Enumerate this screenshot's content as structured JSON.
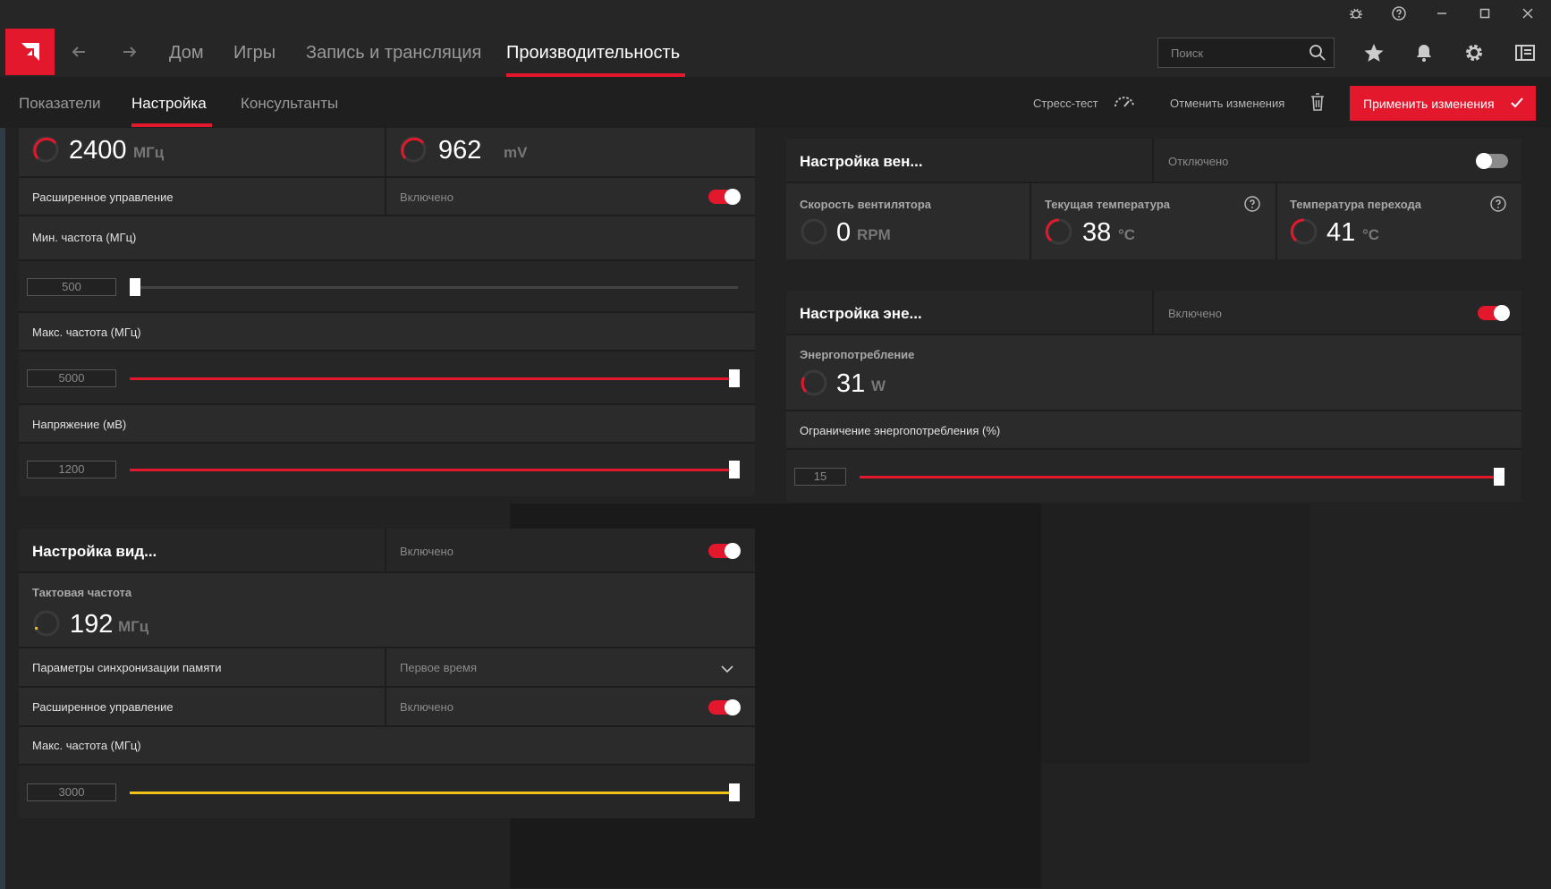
{
  "colors": {
    "accent": "#e3182d",
    "yellow": "#f2c21b",
    "panel": "#2b2b2b"
  },
  "nav": {
    "tabs": [
      {
        "label": "Дом"
      },
      {
        "label": "Игры"
      },
      {
        "label": "Запись и трансляция"
      },
      {
        "label": "Производительность"
      }
    ],
    "active_tab": "Производительность",
    "search_placeholder": "Поиск"
  },
  "subnav": {
    "tabs": [
      {
        "label": "Показатели"
      },
      {
        "label": "Настройка"
      },
      {
        "label": "Консультанты"
      }
    ],
    "active_tab": "Настройка",
    "stress_test": "Стресс-тест",
    "discard": "Отменить изменения",
    "apply": "Применить изменения"
  },
  "gpu": {
    "freq_value": "2400",
    "freq_unit": "МГц",
    "volt_value": "962",
    "volt_unit": "mV",
    "advanced": {
      "label": "Расширенное управление",
      "state": "Включено",
      "on": true
    },
    "min_freq": {
      "label": "Мин. частота (МГц)",
      "value": "500",
      "fraction": 0.0
    },
    "max_freq": {
      "label": "Макс. частота (МГц)",
      "value": "5000",
      "fraction": 1.0
    },
    "voltage": {
      "label": "Напряжение (мВ)",
      "value": "1200",
      "fraction": 1.0
    }
  },
  "vram": {
    "title": "Настройка вид...",
    "state": "Включено",
    "on": true,
    "clock_label": "Тактовая частота",
    "clock_value": "192",
    "clock_unit": "МГц",
    "timing": {
      "label": "Параметры синхронизации памяти",
      "value": "Первое время"
    },
    "advanced": {
      "label": "Расширенное управление",
      "state": "Включено",
      "on": true
    },
    "max_freq": {
      "label": "Макс. частота (МГц)",
      "value": "3000",
      "fraction": 1.0
    }
  },
  "fan": {
    "title": "Настройка вен...",
    "state": "Отключено",
    "on": false,
    "speed": {
      "label": "Скорость вентилятора",
      "value": "0",
      "unit": "RPM"
    },
    "temp": {
      "label": "Текущая температура",
      "value": "38",
      "unit": "°C"
    },
    "junction": {
      "label": "Температура перехода",
      "value": "41",
      "unit": "°C"
    }
  },
  "power": {
    "title": "Настройка эне...",
    "state": "Включено",
    "on": true,
    "consumption_label": "Энергопотребление",
    "consumption_value": "31",
    "consumption_unit": "W",
    "limit": {
      "label": "Ограничение энергопотребления (%)",
      "value": "15",
      "fraction": 1.0
    }
  }
}
